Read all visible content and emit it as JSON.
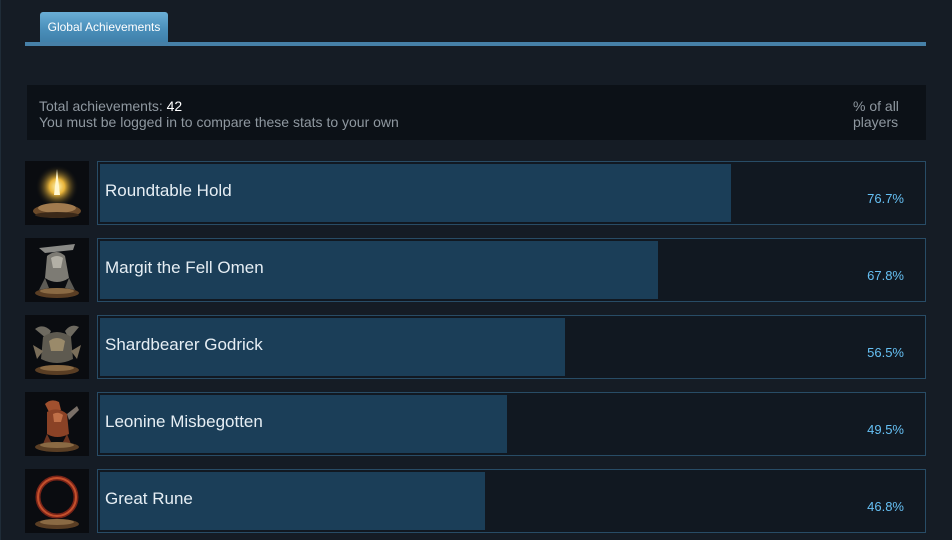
{
  "tabs": {
    "global_achievements": "Global Achievements"
  },
  "summary": {
    "total_label": "Total achievements:",
    "total_count": "42",
    "login_note": "You must be logged in to compare these stats to your own",
    "pct_header": "% of all players"
  },
  "colors": {
    "accent": "#66c0f4",
    "bar_fill": "#1b3e58",
    "tab": "#4a8fba"
  },
  "achievements": [
    {
      "name": "Roundtable Hold",
      "percent_text": "76.7%",
      "percent": 76.7,
      "icon": "roundtable-hold-icon"
    },
    {
      "name": "Margit the Fell Omen",
      "percent_text": "67.8%",
      "percent": 67.8,
      "icon": "margit-icon"
    },
    {
      "name": "Shardbearer Godrick",
      "percent_text": "56.5%",
      "percent": 56.5,
      "icon": "godrick-icon"
    },
    {
      "name": "Leonine Misbegotten",
      "percent_text": "49.5%",
      "percent": 49.5,
      "icon": "leonine-misbegotten-icon"
    },
    {
      "name": "Great Rune",
      "percent_text": "46.8%",
      "percent": 46.8,
      "icon": "great-rune-icon"
    }
  ]
}
